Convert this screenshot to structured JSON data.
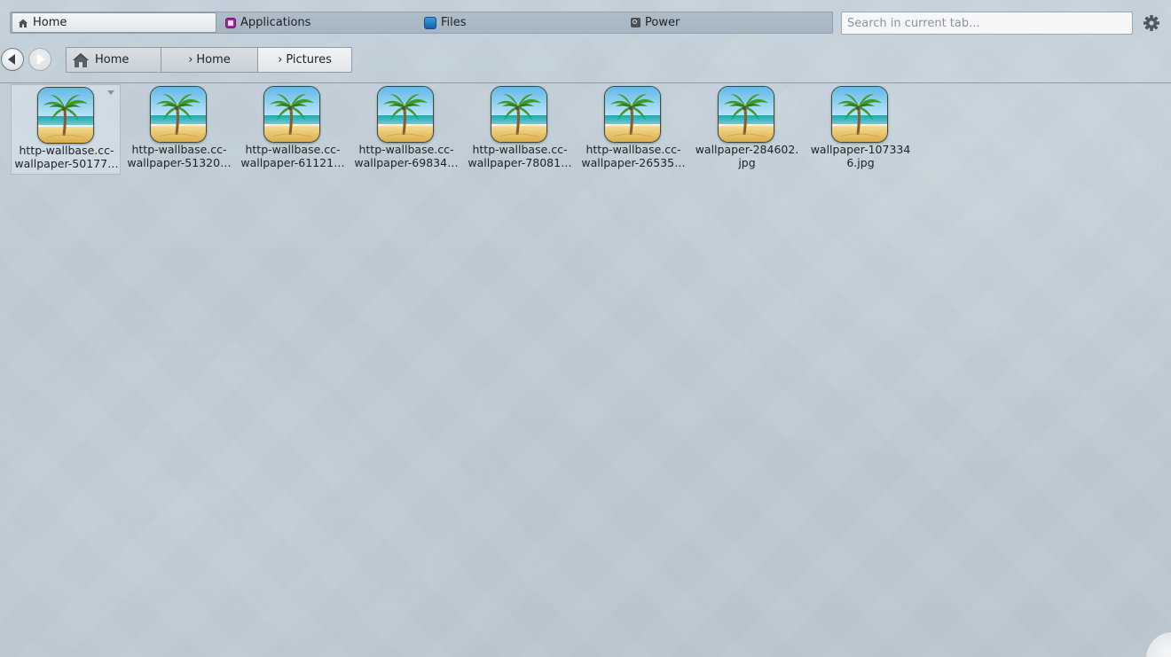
{
  "tabs": [
    {
      "label": "Home",
      "icon": "home-icon",
      "active": true
    },
    {
      "label": "Applications",
      "icon": "applications-icon",
      "active": false
    },
    {
      "label": "Files",
      "icon": "files-icon",
      "active": false
    },
    {
      "label": "Power",
      "icon": "power-icon",
      "active": false
    }
  ],
  "search": {
    "placeholder": "Search in current tab..."
  },
  "settings": {
    "icon": "gear-icon"
  },
  "nav": {
    "back_icon": "back-arrow-icon",
    "forward_icon": "forward-arrow-icon"
  },
  "breadcrumb": {
    "items": [
      {
        "label": "Home",
        "separator": "",
        "icon": "home-icon"
      },
      {
        "label": "Home",
        "separator": "›"
      },
      {
        "label": "Pictures",
        "separator": "›",
        "current": true
      }
    ]
  },
  "files": [
    {
      "line1": "http-wallbase.cc-",
      "line2": "wallpaper-50177…",
      "selected": true
    },
    {
      "line1": "http-wallbase.cc-",
      "line2": "wallpaper-51320…"
    },
    {
      "line1": "http-wallbase.cc-",
      "line2": "wallpaper-61121…"
    },
    {
      "line1": "http-wallbase.cc-",
      "line2": "wallpaper-69834…"
    },
    {
      "line1": "http-wallbase.cc-",
      "line2": "wallpaper-78081…"
    },
    {
      "line1": "http-wallbase.cc-",
      "line2": "wallpaper-26535…"
    },
    {
      "line1": "wallpaper-284602.",
      "line2": "jpg"
    },
    {
      "line1": "wallpaper-107334",
      "line2": "6.jpg"
    }
  ],
  "colors": {
    "accent_apps": "#a2279e",
    "accent_files": "#1e73c4"
  }
}
